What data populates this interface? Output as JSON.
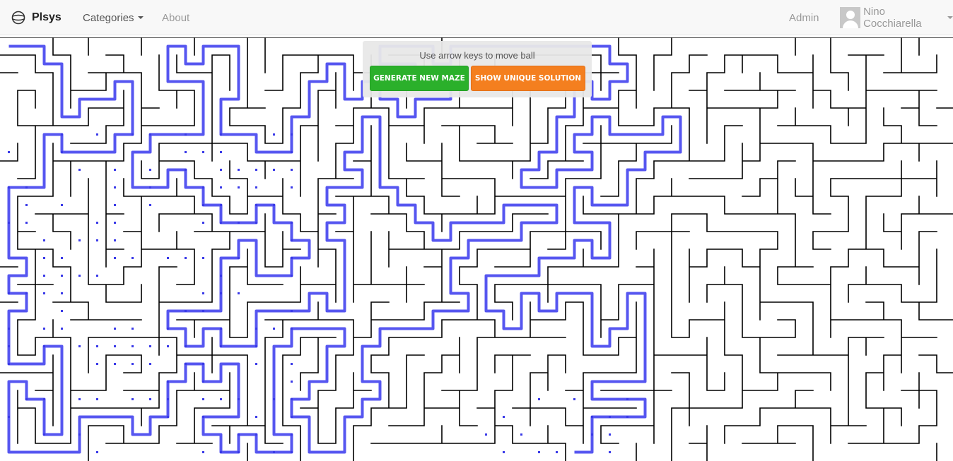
{
  "navbar": {
    "brand": "Plsys",
    "brand_icon": "globe-icon",
    "categories_label": "Categories",
    "about_label": "About",
    "admin_label": "Admin",
    "user_name": "Nino Cocchiarella"
  },
  "controls": {
    "instructions": "Use arrow keys to move ball",
    "generate_label": "GENERATE NEW MAZE",
    "solution_label": "SHOW UNIQUE SOLUTION"
  },
  "colors": {
    "generate_button": "#2bb02b",
    "solution_button": "#f47f1f",
    "maze_wall": "#000000",
    "solution_path": "#5656f0",
    "visited_dot": "#3a3ae8"
  }
}
